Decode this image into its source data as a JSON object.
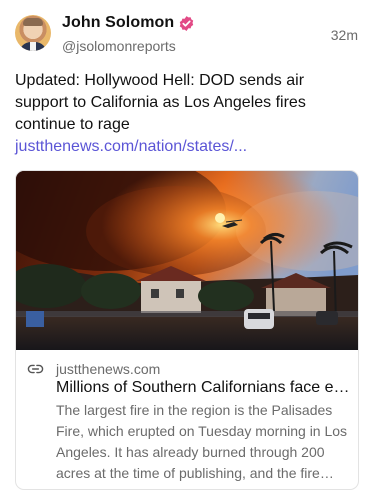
{
  "author": {
    "name": "John Solomon",
    "handle": "@jsolomonreports",
    "verified_color": "#e24a86"
  },
  "post": {
    "time": "32m",
    "text": "Updated: Hollywood Hell: DOD sends air support to California as Los Angeles fires continue to rage ",
    "link_text": "justthenews.com/nation/states/..."
  },
  "card": {
    "image_alt": "wildfire-smoke-over-houses",
    "link_icon": "link-icon",
    "domain": "justthenews.com",
    "title": "Millions of Southern Californians face extreme fire danger",
    "description": "The largest fire in the region is the Palisades Fire, which erupted on Tuesday morning in Los Angeles. It has already burned through 200 acres at the time of publishing, and the fire continues to spread."
  },
  "colors": {
    "link": "#5b55d6",
    "muted": "#6b6b6b"
  }
}
